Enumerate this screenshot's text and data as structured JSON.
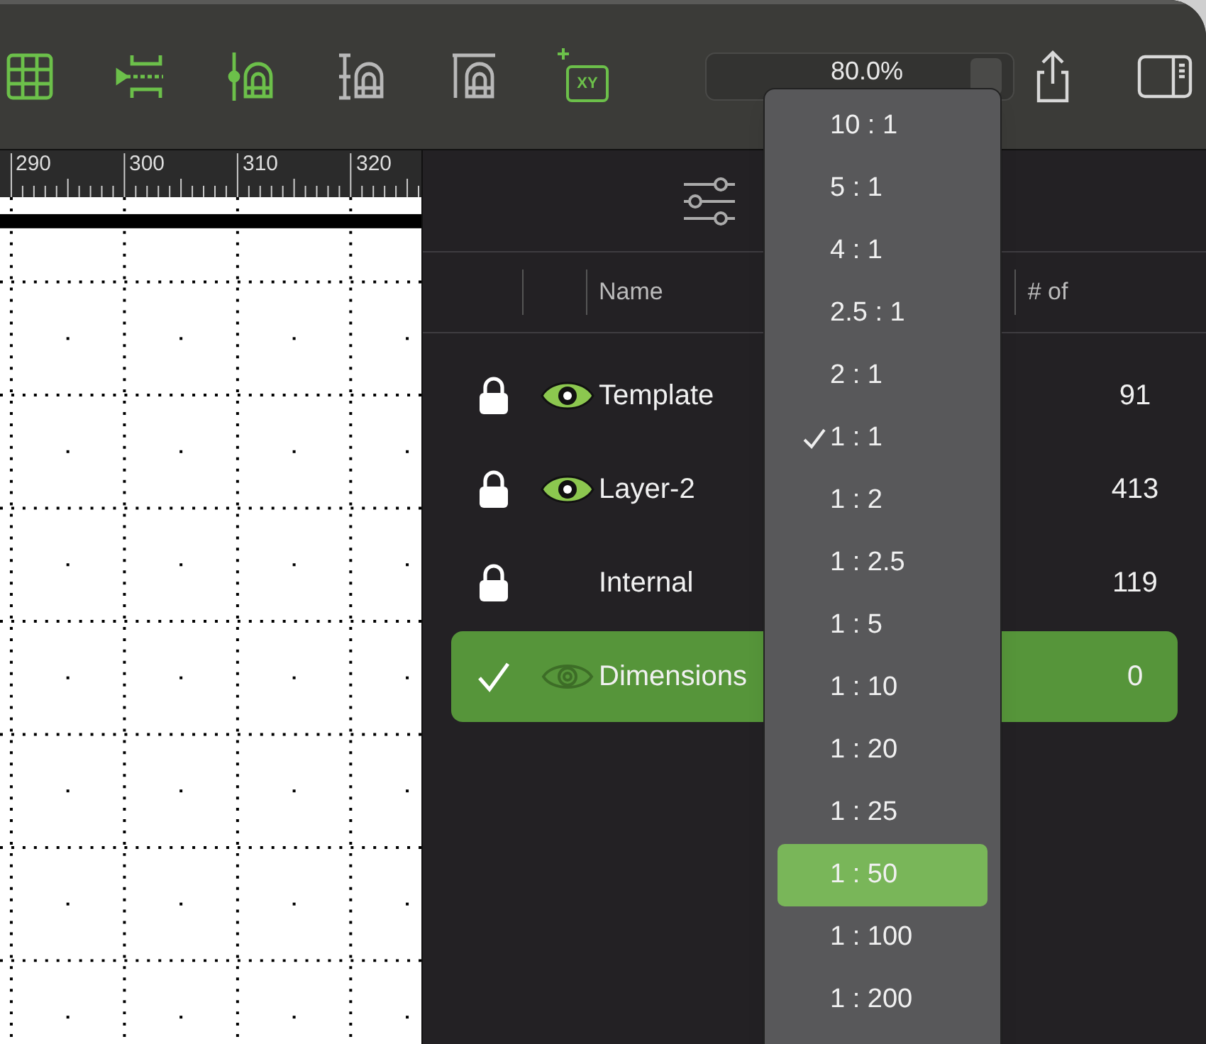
{
  "toolbar": {
    "tools": [
      {
        "kind": "grid",
        "disabled": false
      },
      {
        "kind": "gap",
        "disabled": false
      },
      {
        "kind": "arch-pin",
        "disabled": false
      },
      {
        "kind": "arch-dim",
        "disabled": true
      },
      {
        "kind": "arch-top",
        "disabled": true
      },
      {
        "kind": "xy",
        "label": "XY",
        "disabled": false
      }
    ],
    "zoom": {
      "value": "80.0%"
    }
  },
  "ruler": {
    "labels": [
      "290",
      "300",
      "310",
      "320"
    ]
  },
  "layers": {
    "columns": [
      "Name",
      "# of"
    ],
    "rows": [
      {
        "name": "Template",
        "count": "91",
        "locked": true,
        "visible": true,
        "selected": false
      },
      {
        "name": "Layer-2",
        "count": "413",
        "locked": true,
        "visible": true,
        "selected": false
      },
      {
        "name": "Internal",
        "count": "119",
        "locked": true,
        "visible": false,
        "selected": false
      },
      {
        "name": "Dimensions",
        "count": "0",
        "locked": false,
        "visible": true,
        "selected": true
      }
    ]
  },
  "scale_menu": {
    "items": [
      {
        "label": "10 : 1",
        "checked": false,
        "selected": false
      },
      {
        "label": "5 : 1",
        "checked": false,
        "selected": false
      },
      {
        "label": "4 : 1",
        "checked": false,
        "selected": false
      },
      {
        "label": "2.5 : 1",
        "checked": false,
        "selected": false
      },
      {
        "label": "2 : 1",
        "checked": false,
        "selected": false
      },
      {
        "label": "1 : 1",
        "checked": true,
        "selected": false
      },
      {
        "label": "1 : 2",
        "checked": false,
        "selected": false
      },
      {
        "label": "1 : 2.5",
        "checked": false,
        "selected": false
      },
      {
        "label": "1 : 5",
        "checked": false,
        "selected": false
      },
      {
        "label": "1 : 10",
        "checked": false,
        "selected": false
      },
      {
        "label": "1 : 20",
        "checked": false,
        "selected": false
      },
      {
        "label": "1 : 25",
        "checked": false,
        "selected": false
      },
      {
        "label": "1 : 50",
        "checked": false,
        "selected": true
      },
      {
        "label": "1 : 100",
        "checked": false,
        "selected": false
      },
      {
        "label": "1 : 200",
        "checked": false,
        "selected": false
      }
    ]
  }
}
